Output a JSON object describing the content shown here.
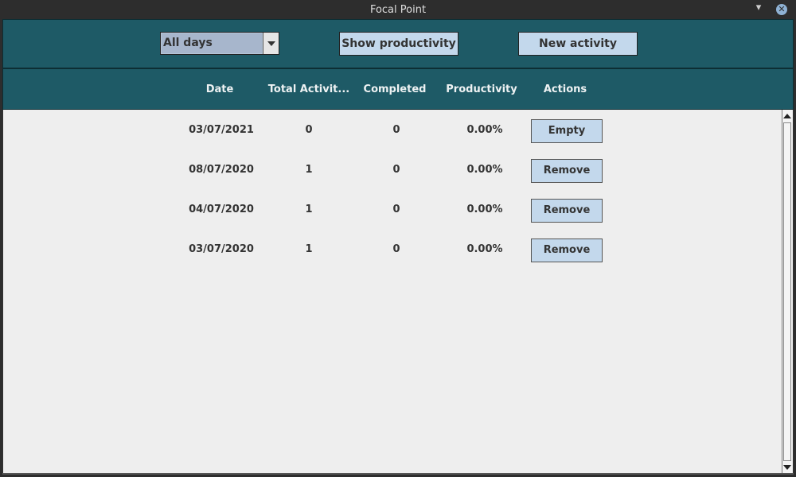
{
  "window": {
    "title": "Focal Point",
    "minimize_glyph": "▾",
    "close_glyph": "✕"
  },
  "toolbar": {
    "filter_selected": "All days",
    "show_productivity_label": "Show productivity",
    "new_activity_label": "New activity"
  },
  "table": {
    "headers": {
      "date": "Date",
      "total": "Total Activit...",
      "completed": "Completed",
      "productivity": "Productivity",
      "actions": "Actions"
    },
    "rows": [
      {
        "date": "03/07/2021",
        "total": "0",
        "completed": "0",
        "productivity": "0.00%",
        "action": "Empty"
      },
      {
        "date": "08/07/2020",
        "total": "1",
        "completed": "0",
        "productivity": "0.00%",
        "action": "Remove"
      },
      {
        "date": "04/07/2020",
        "total": "1",
        "completed": "0",
        "productivity": "0.00%",
        "action": "Remove"
      },
      {
        "date": "03/07/2020",
        "total": "1",
        "completed": "0",
        "productivity": "0.00%",
        "action": "Remove"
      }
    ]
  },
  "colors": {
    "header_bg": "#1e5a66",
    "button_bg": "#c3d8ec",
    "body_bg": "#eeeeee"
  }
}
